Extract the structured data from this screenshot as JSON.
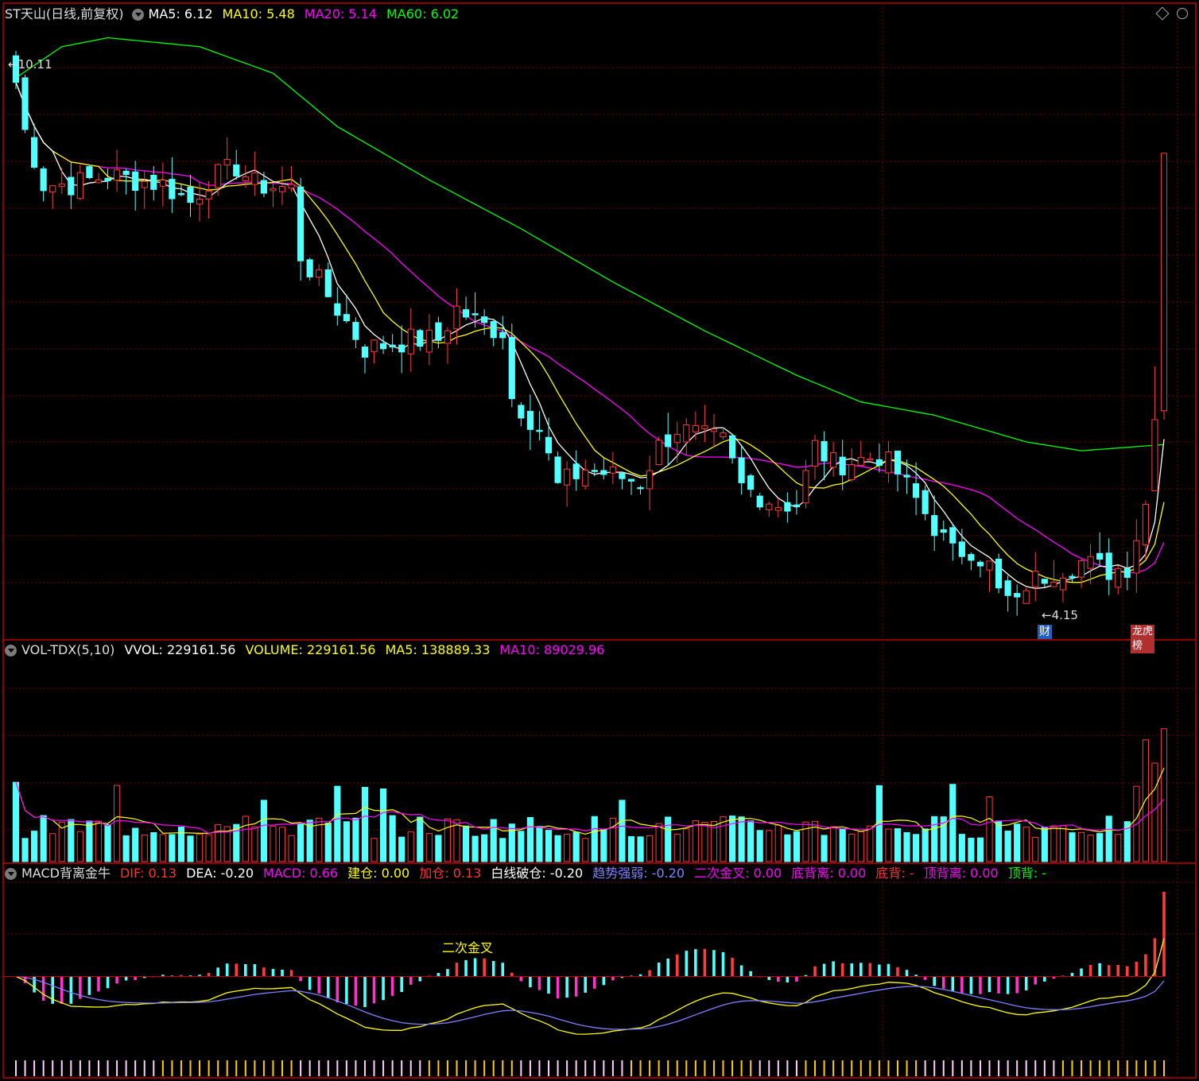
{
  "price_panel": {
    "title": "ST天山(日线,前复权)",
    "indicators": [
      {
        "label": "MA5: 6.12",
        "color": "#ffffff"
      },
      {
        "label": "MA10: 5.48",
        "color": "#ffff00"
      },
      {
        "label": "MA20: 5.14",
        "color": "#ff00ff"
      },
      {
        "label": "MA60: 6.02",
        "color": "#00ff00"
      }
    ],
    "high_label": "10.11",
    "low_label": "4.15",
    "tag_cai": "财",
    "tag_bang": "龙虎榜"
  },
  "vol_panel": {
    "indicators": [
      {
        "label": "VOL-TDX(5,10)",
        "color": "#dddddd"
      },
      {
        "label": "VVOL: 229161.56",
        "color": "#ffffff"
      },
      {
        "label": "VOLUME: 229161.56",
        "color": "#ffff00"
      },
      {
        "label": "MA5: 138889.33",
        "color": "#ffff00"
      },
      {
        "label": "MA10: 89029.96",
        "color": "#ff00ff"
      }
    ]
  },
  "macd_panel": {
    "indicators": [
      {
        "label": "MACD背离金牛",
        "color": "#dddddd"
      },
      {
        "label": "DIF: 0.13",
        "color": "#ff3333"
      },
      {
        "label": "DEA: -0.20",
        "color": "#ffffff"
      },
      {
        "label": "MACD: 0.66",
        "color": "#ff00ff"
      },
      {
        "label": "建仓: 0.00",
        "color": "#ffff00"
      },
      {
        "label": "加仓: 0.13",
        "color": "#ff3333"
      },
      {
        "label": "白线破仓: -0.20",
        "color": "#ffffff"
      },
      {
        "label": "趋势强弱: -0.20",
        "color": "#8080ff"
      },
      {
        "label": "二次金叉: 0.00",
        "color": "#ff00ff"
      },
      {
        "label": "底背离: 0.00",
        "color": "#ff00ff"
      },
      {
        "label": "底背: -",
        "color": "#ff3333"
      },
      {
        "label": "顶背离: 0.00",
        "color": "#ff00ff"
      },
      {
        "label": "顶背: -",
        "color": "#00ff00"
      }
    ],
    "annotation": "二次金叉"
  },
  "colors": {
    "up": "#ff3b3b",
    "down": "#54ffff",
    "ma5": "#ffffff",
    "ma10": "#ffff00",
    "ma20": "#ff00ff",
    "ma60": "#00ff00",
    "frame": "#c00000",
    "grid": "#7a0000",
    "dif": "#ffff00",
    "dea": "#8080ff",
    "macd_white": "#ffffff"
  },
  "chart_data": {
    "type": "candlestick",
    "candles_n": 126,
    "ylim": [
      4.0,
      10.9
    ],
    "price_path": [
      [
        0,
        10.1
      ],
      [
        1,
        9.55
      ],
      [
        3,
        8.95
      ],
      [
        6,
        8.95
      ],
      [
        10,
        9.05
      ],
      [
        16,
        8.95
      ],
      [
        19,
        8.75
      ],
      [
        21,
        9.0
      ],
      [
        24,
        9.15
      ],
      [
        26,
        8.95
      ],
      [
        30,
        8.9
      ],
      [
        31,
        8.15
      ],
      [
        33,
        7.85
      ],
      [
        36,
        7.4
      ],
      [
        38,
        7.1
      ],
      [
        43,
        7.2
      ],
      [
        46,
        7.2
      ],
      [
        48,
        7.55
      ],
      [
        51,
        7.35
      ],
      [
        53,
        7.3
      ],
      [
        54,
        6.55
      ],
      [
        57,
        6.2
      ],
      [
        59,
        5.55
      ],
      [
        62,
        5.75
      ],
      [
        66,
        5.65
      ],
      [
        68,
        5.6
      ],
      [
        70,
        6.0
      ],
      [
        72,
        6.2
      ],
      [
        75,
        6.1
      ],
      [
        77,
        6.05
      ],
      [
        79,
        5.55
      ],
      [
        83,
        5.35
      ],
      [
        85,
        5.35
      ],
      [
        87,
        6.0
      ],
      [
        89,
        5.8
      ],
      [
        92,
        5.85
      ],
      [
        94,
        5.9
      ],
      [
        96,
        5.7
      ],
      [
        99,
        5.25
      ],
      [
        102,
        4.8
      ],
      [
        104,
        4.85
      ],
      [
        106,
        4.65
      ],
      [
        107,
        4.35
      ],
      [
        109,
        4.2
      ],
      [
        110,
        4.45
      ],
      [
        113,
        4.6
      ],
      [
        116,
        4.7
      ],
      [
        119,
        4.6
      ],
      [
        121,
        4.65
      ],
      [
        123,
        5.35
      ],
      [
        124,
        5.95
      ],
      [
        125,
        6.4
      ]
    ],
    "ma60_path": [
      [
        0,
        10.15
      ],
      [
        5,
        10.5
      ],
      [
        10,
        10.6
      ],
      [
        20,
        10.5
      ],
      [
        28,
        10.2
      ],
      [
        35,
        9.6
      ],
      [
        45,
        9.0
      ],
      [
        55,
        8.45
      ],
      [
        65,
        7.85
      ],
      [
        75,
        7.3
      ],
      [
        85,
        6.8
      ],
      [
        92,
        6.5
      ],
      [
        100,
        6.35
      ],
      [
        110,
        6.05
      ],
      [
        116,
        5.95
      ],
      [
        125,
        6.02
      ]
    ],
    "vol_ylim": [
      0,
      340000
    ],
    "vol_last": 229161.56,
    "macd_ylim": [
      -0.9,
      0.9
    ],
    "dif_last": 0.13,
    "dea_last": -0.2,
    "macd_last": 0.66
  }
}
